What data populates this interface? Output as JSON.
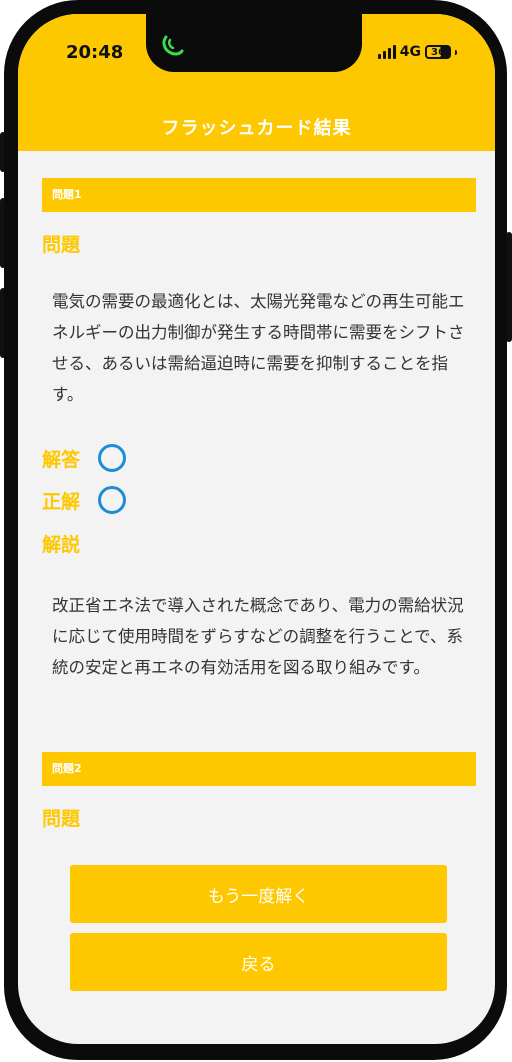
{
  "status": {
    "time": "20:48",
    "network": "4G",
    "battery": "36"
  },
  "header": {
    "title": "フラッシュカード結果"
  },
  "question1": {
    "bar_label": "問題1",
    "question_label": "問題",
    "question_text": "電気の需要の最適化とは、太陽光発電などの再生可能エネルギーの出力制御が発生する時間帯に需要をシフトさせる、あるいは需給逼迫時に需要を抑制することを指す。",
    "answer_label": "解答",
    "correct_label": "正解",
    "explanation_label": "解説",
    "explanation_text": "改正省エネ法で導入された概念であり、電力の需給状況に応じて使用時間をずらすなどの調整を行うことで、系統の安定と再エネの有効活用を図る取り組みです。"
  },
  "question2": {
    "bar_label": "問題2",
    "question_label": "問題"
  },
  "buttons": {
    "retry": "もう一度解く",
    "back": "戻る"
  },
  "colors": {
    "accent": "#fec800",
    "circle": "#1a8fd6",
    "background": "#f2f3f2"
  }
}
